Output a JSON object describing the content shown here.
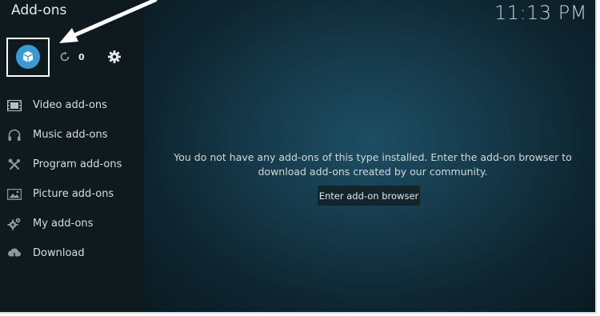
{
  "header": {
    "title": "Add-ons",
    "clock": "11:13 PM"
  },
  "toolbar": {
    "addon_browser_icon": "open-box-icon",
    "refresh_icon": "refresh-icon",
    "update_count": "0",
    "settings_icon": "gear-icon"
  },
  "sidebar": {
    "items": [
      {
        "label": "Video add-ons",
        "icon": "film-icon"
      },
      {
        "label": "Music add-ons",
        "icon": "headphones-icon"
      },
      {
        "label": "Program add-ons",
        "icon": "tools-icon"
      },
      {
        "label": "Picture add-ons",
        "icon": "image-icon"
      },
      {
        "label": "My add-ons",
        "icon": "gears-icon"
      },
      {
        "label": "Download",
        "icon": "cloud-download-icon"
      }
    ]
  },
  "main": {
    "message": "You do not have any add-ons of this type installed. Enter the add-on browser to download add-ons created by our community.",
    "browser_button": "Enter add-on browser"
  },
  "colors": {
    "accent": "#3a9ad1",
    "sidebar_bg": "#0f1a1f",
    "main_bg": "#163b4c"
  }
}
